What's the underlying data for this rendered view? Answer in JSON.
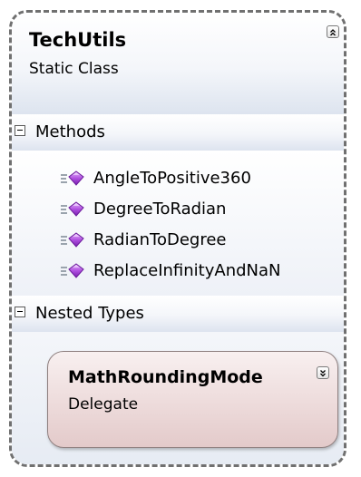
{
  "class_shape": {
    "name": "TechUtils",
    "stereotype": "Static Class",
    "collapse_icon": "double-chevron-up-icon"
  },
  "methods_section": {
    "label": "Methods",
    "toggle_icon": "minus-box-icon",
    "item_icon": "method-icon",
    "items": [
      {
        "label": "AngleToPositive360"
      },
      {
        "label": "DegreeToRadian"
      },
      {
        "label": "RadianToDegree"
      },
      {
        "label": "ReplaceInfinityAndNaN"
      }
    ]
  },
  "nested_types_section": {
    "label": "Nested Types",
    "toggle_icon": "minus-box-icon",
    "delegate": {
      "name": "MathRoundingMode",
      "stereotype": "Delegate",
      "expand_icon": "double-chevron-down-icon"
    }
  },
  "colors": {
    "border": "#707070",
    "header_gradient_end": "#dde4ef",
    "delegate_fill": "#ecd9d9",
    "method_icon": "#a64fd1"
  }
}
